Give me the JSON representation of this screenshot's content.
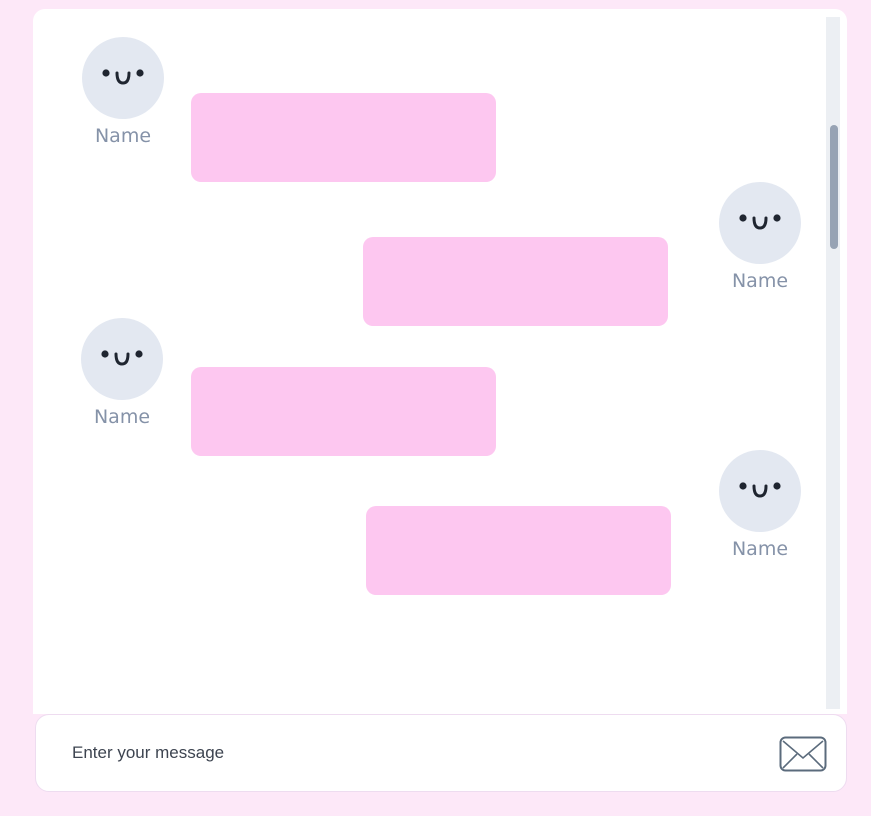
{
  "messages": [
    {
      "side": "left",
      "sender_name": "Name",
      "text": ""
    },
    {
      "side": "right",
      "sender_name": "Name",
      "text": ""
    },
    {
      "side": "left",
      "sender_name": "Name",
      "text": ""
    },
    {
      "side": "right",
      "sender_name": "Name",
      "text": ""
    }
  ],
  "composer": {
    "placeholder": "Enter your message",
    "value": "",
    "send_icon": "envelope-icon"
  },
  "colors": {
    "page_background": "#fde8f8",
    "bubble": "#fdc7f0",
    "avatar": "#e3e8f1",
    "name_text": "#8592a8"
  }
}
